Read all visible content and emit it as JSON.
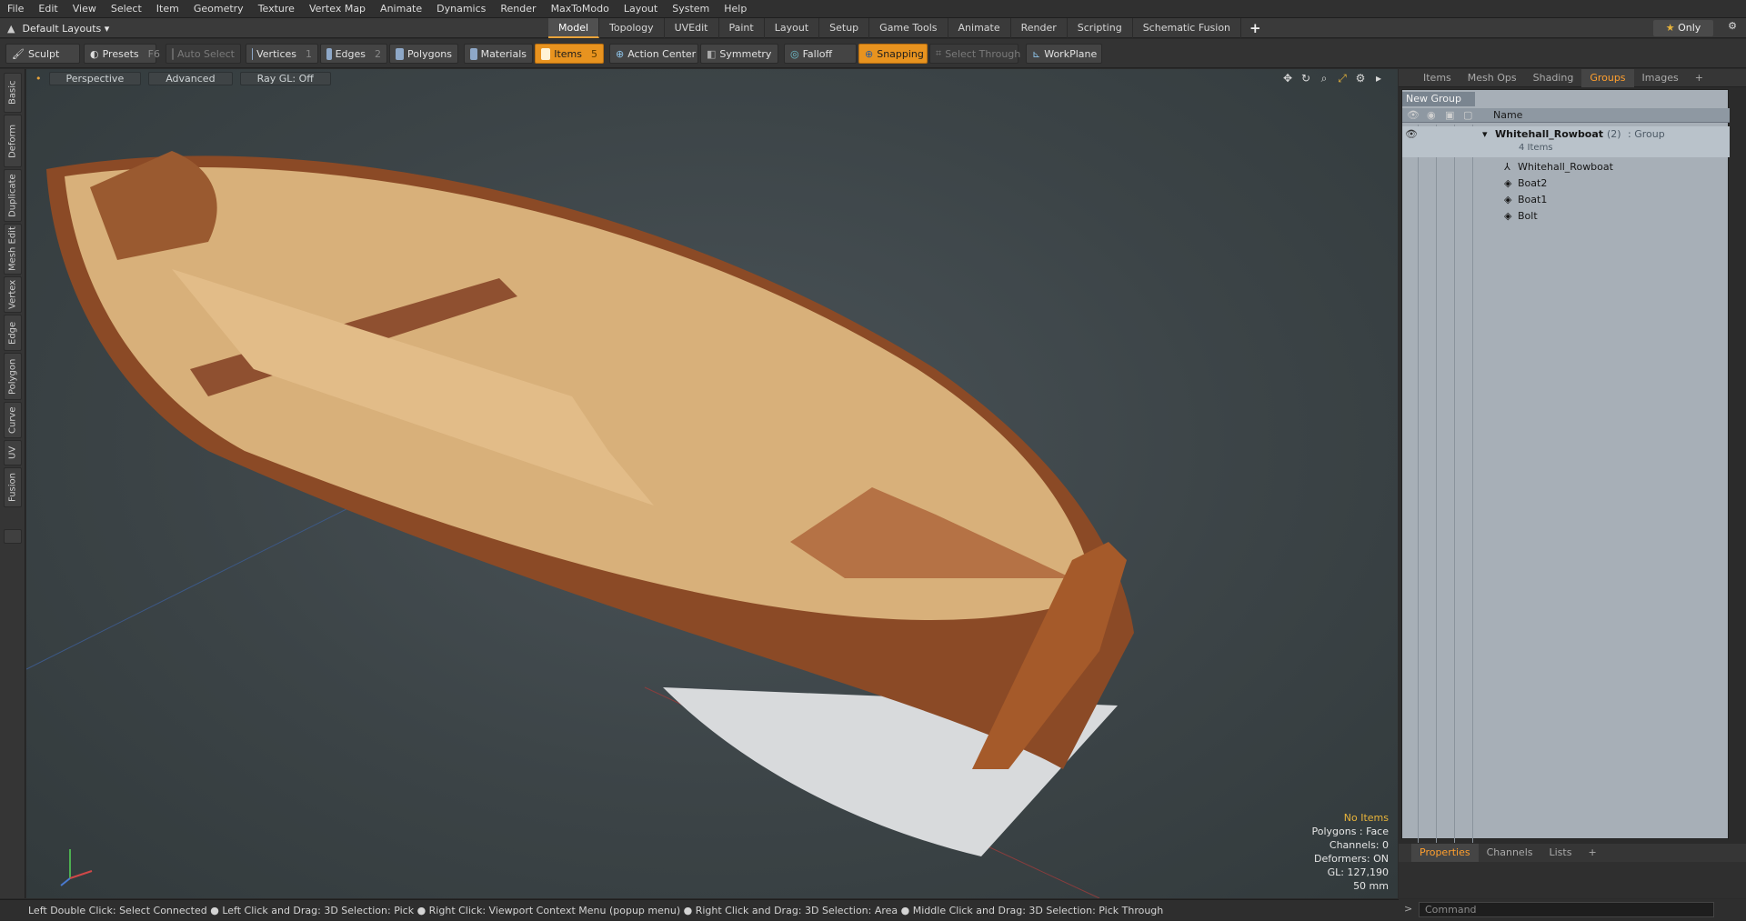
{
  "menu": [
    "File",
    "Edit",
    "View",
    "Select",
    "Item",
    "Geometry",
    "Texture",
    "Vertex Map",
    "Animate",
    "Dynamics",
    "Render",
    "MaxToModo",
    "Layout",
    "System",
    "Help"
  ],
  "layouts": {
    "label": "Default Layouts"
  },
  "tabs": [
    "Model",
    "Topology",
    "UVEdit",
    "Paint",
    "Layout",
    "Setup",
    "Game Tools",
    "Animate",
    "Render",
    "Scripting",
    "Schematic Fusion"
  ],
  "tabs_plus": "+",
  "only": "Only",
  "toolbar": {
    "sculpt": "Sculpt",
    "presets": "Presets",
    "presets_key": "F6",
    "auto_select": "Auto Select",
    "vertices": "Vertices",
    "vertices_n": "1",
    "edges": "Edges",
    "edges_n": "2",
    "polygons": "Polygons",
    "materials": "Materials",
    "items": "Items",
    "items_n": "5",
    "action_center": "Action Center",
    "symmetry": "Symmetry",
    "falloff": "Falloff",
    "snapping": "Snapping",
    "select_through": "Select Through",
    "workplane": "WorkPlane"
  },
  "left_tabs": [
    "Basic",
    "Deform",
    "Duplicate",
    "Mesh Edit",
    "Vertex",
    "Edge",
    "Polygon",
    "Curve",
    "UV",
    "Fusion"
  ],
  "viewport": {
    "perspective": "Perspective",
    "advanced": "Advanced",
    "raygl": "Ray GL: Off"
  },
  "stats": {
    "no_items": "No Items",
    "polygons": "Polygons : Face",
    "channels": "Channels: 0",
    "deformers": "Deformers: ON",
    "gl": "GL: 127,190",
    "mm": "50 mm"
  },
  "status": "Left Double Click: Select Connected ● Left Click and Drag: 3D Selection: Pick ● Right Click: Viewport Context Menu (popup menu) ● Right Click and Drag: 3D Selection: Area ● Middle Click and Drag: 3D Selection: Pick Through",
  "panel_tabs": [
    "Items",
    "Mesh Ops",
    "Shading",
    "Groups",
    "Images",
    "+"
  ],
  "panel": {
    "new_group": "New Group",
    "name_col": "Name",
    "group_name": "Whitehall_Rowboat",
    "group_count": "(2)",
    "group_type": ": Group",
    "group_items": "4 Items",
    "children": [
      "Whitehall_Rowboat",
      "Boat2",
      "Boat1",
      "Bolt"
    ]
  },
  "bottom_tabs": [
    "Properties",
    "Channels",
    "Lists",
    "+"
  ],
  "command_placeholder": "Command",
  "colors": {
    "accent": "#e8931f",
    "tab_active": "#ff9f2e"
  }
}
